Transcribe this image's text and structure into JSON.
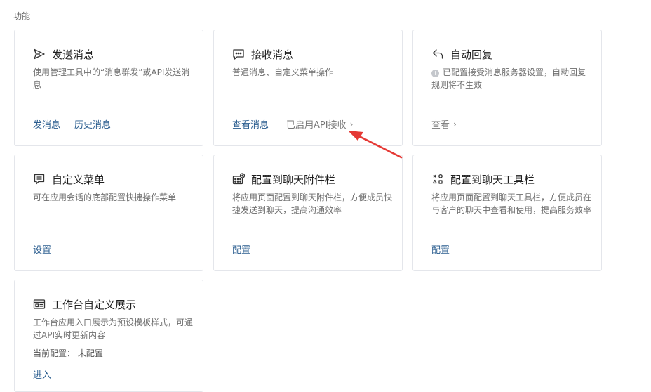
{
  "section": {
    "title": "功能"
  },
  "cards": {
    "send": {
      "title": "发送消息",
      "desc": "使用管理工具中的“消息群发”或API发送消息",
      "actions": [
        "发消息",
        "历史消息"
      ]
    },
    "receive": {
      "title": "接收消息",
      "desc": "普通消息、自定义菜单操作",
      "action": "查看消息",
      "status": "已启用API接收"
    },
    "autoreply": {
      "title": "自动回复",
      "desc": "已配置接受消息服务器设置，自动回复规则将不生效",
      "action": "查看"
    },
    "menu": {
      "title": "自定义菜单",
      "desc": "可在应用会话的底部配置快捷操作菜单",
      "action": "设置"
    },
    "attach": {
      "title": "配置到聊天附件栏",
      "desc": "将应用页面配置到聊天附件栏，方便成员快捷发送到聊天，提高沟通效率",
      "action": "配置"
    },
    "toolbar": {
      "title": "配置到聊天工具栏",
      "desc": "将应用页面配置到聊天工具栏，方便成员在与客户的聊天中查看和使用，提高服务效率",
      "action": "配置"
    },
    "workbench": {
      "title": "工作台自定义展示",
      "desc": "工作台应用入口展示为预设模板样式，可通过API实时更新内容",
      "current_config": "当前配置： 未配置",
      "action": "进入"
    }
  },
  "icons": {
    "send": "paper-plane-icon",
    "receive": "chat-bubble-icon",
    "autoreply": "reply-arrow-icon",
    "menu": "menu-list-icon",
    "attach": "attachment-bar-icon",
    "toolbar": "toolbar-icon",
    "workbench": "workbench-card-icon",
    "info": "info-icon",
    "chevron": "chevron-right-icon"
  },
  "colors": {
    "link": "#2a5d8f",
    "annotation_arrow": "#e53935",
    "border": "#e4e6eb"
  }
}
